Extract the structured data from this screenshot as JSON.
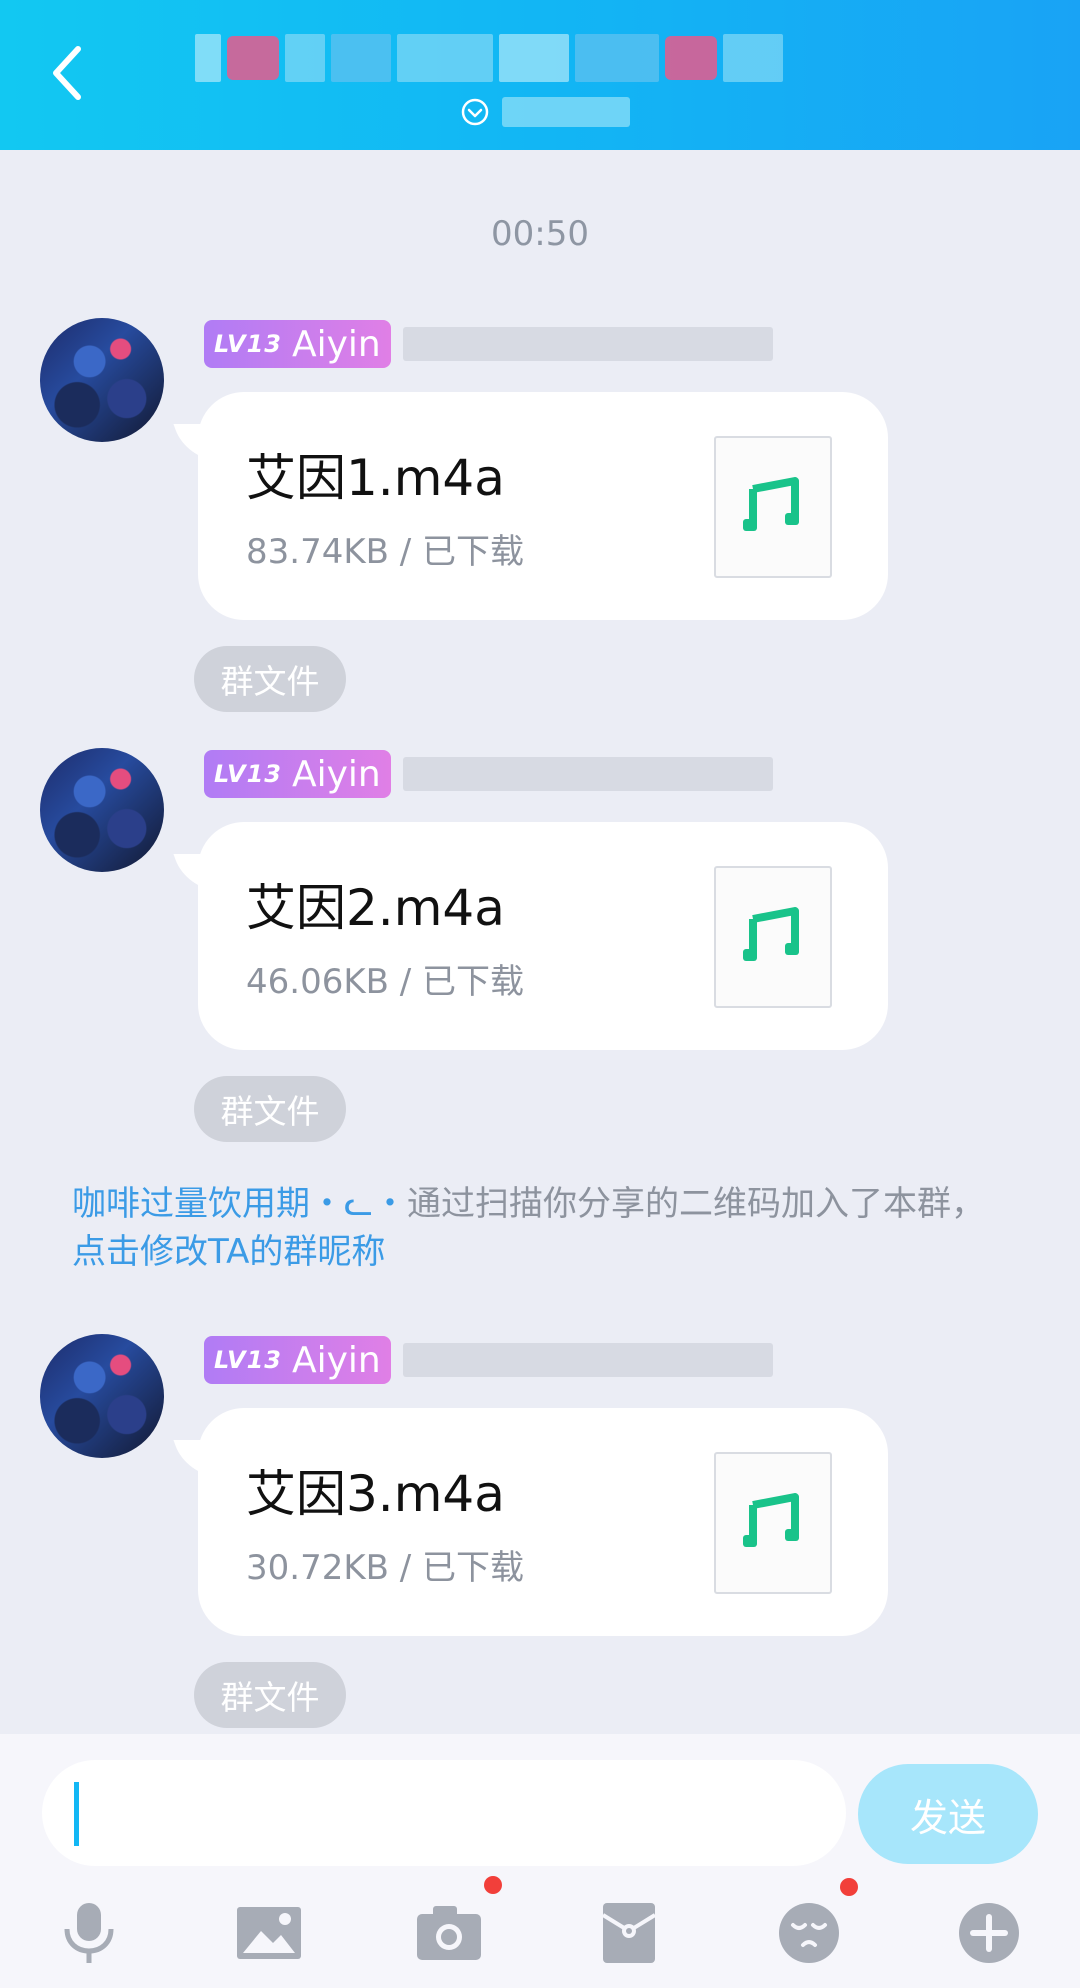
{
  "header": {
    "back_icon": "chevron-left-icon",
    "group_dropdown_icon": "chevron-down-circle-icon"
  },
  "chat": {
    "timestamp": "00:50",
    "messages": [
      {
        "level": "LV13",
        "sender_title": "Aiyin",
        "file_name": "艾因1.m4a",
        "file_meta": "83.74KB / 已下载",
        "file_icon": "music-note-icon",
        "tag": "群文件"
      },
      {
        "level": "LV13",
        "sender_title": "Aiyin",
        "file_name": "艾因2.m4a",
        "file_meta": "46.06KB / 已下载",
        "file_icon": "music-note-icon",
        "tag": "群文件"
      },
      {
        "level": "LV13",
        "sender_title": "Aiyin",
        "file_name": "艾因3.m4a",
        "file_meta": "30.72KB / 已下载",
        "file_icon": "music-note-icon",
        "tag": "群文件"
      }
    ],
    "system_notice": {
      "member_name": "咖啡过量饮用期・ᓚ・",
      "text": "通过扫描你分享的二维码加入了本群，",
      "action_link": "点击修改TA的群昵称"
    }
  },
  "input_bar": {
    "send_label": "发送",
    "tools": [
      {
        "icon": "microphone-icon",
        "badge": false
      },
      {
        "icon": "image-icon",
        "badge": false
      },
      {
        "icon": "camera-icon",
        "badge": true
      },
      {
        "icon": "red-packet-icon",
        "badge": false
      },
      {
        "icon": "emoji-icon",
        "badge": true
      },
      {
        "icon": "plus-circle-icon",
        "badge": false
      }
    ]
  },
  "colors": {
    "header_gradient_start": "#12c8f2",
    "header_gradient_end": "#19a3f5",
    "chat_background": "#ebedf5",
    "music_icon_green": "#19c38a",
    "link_blue": "#3b9be6",
    "level_badge_start": "#b07cf5",
    "level_badge_end": "#e07fe6",
    "send_button": "#a7e6fb",
    "badge_red": "#f23f3a"
  }
}
